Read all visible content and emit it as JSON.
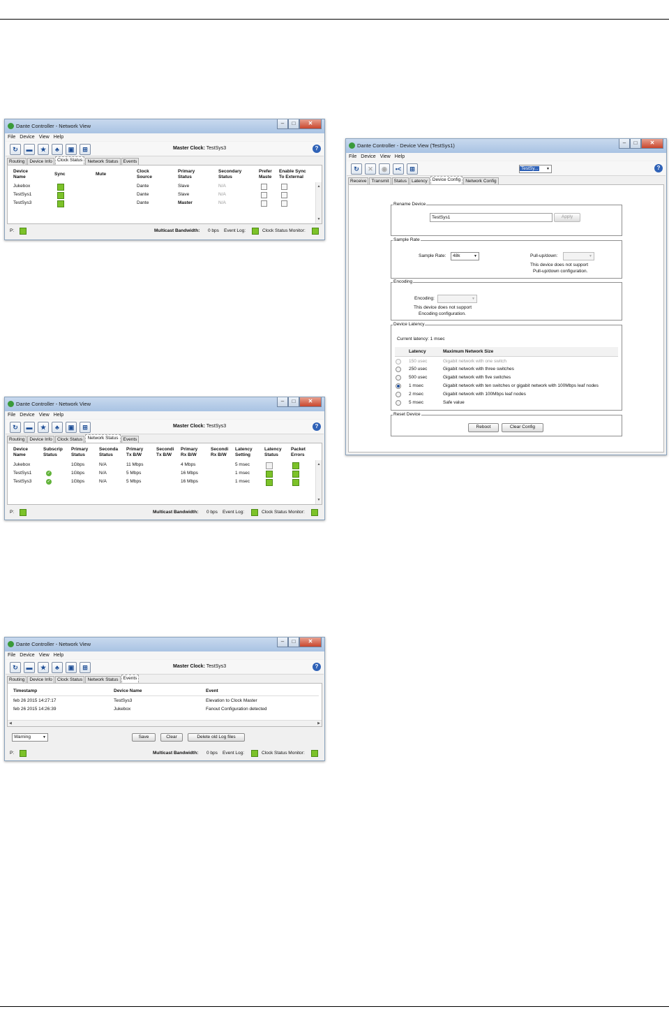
{
  "windows": {
    "network_title": "Dante Controller - Network View",
    "device_title": "Dante Controller - Device View (TestSys1)"
  },
  "menu": [
    "File",
    "Device",
    "View",
    "Help"
  ],
  "network_toolbar": {
    "master_clock_label": "Master Clock:",
    "master_clock_value": "TestSys3"
  },
  "network_tabs": [
    "Routing",
    "Device Info",
    "Clock Status",
    "Network Status",
    "Events"
  ],
  "clock_status": {
    "headers": [
      "Device\nName",
      "Sync",
      "Mute",
      "Clock\nSource",
      "Primary\nStatus",
      "Secondary\nStatus",
      "Prefer\nMaste",
      "Enable Sync\nTo External"
    ],
    "rows": [
      {
        "name": "Jukebox",
        "source": "Dante",
        "primary": "Slave",
        "secondary": "N/A"
      },
      {
        "name": "TestSys1",
        "source": "Dante",
        "primary": "Slave",
        "secondary": "N/A"
      },
      {
        "name": "TestSys3",
        "source": "Dante",
        "primary": "Master",
        "secondary": "N/A"
      }
    ]
  },
  "network_status": {
    "headers": [
      "Device\nName",
      "Subscrip\nStatus",
      "Primary\nStatus",
      "Seconda\nStatus",
      "Primary\nTx B/W",
      "Secondi\nTx B/W",
      "Primary\nRx B/W",
      "Secondi\nRx B/W",
      "Latency\nSetting",
      "Latency\nStatus",
      "Packet\nErrors"
    ],
    "rows": [
      {
        "name": "Jukebox",
        "primary": "1Gbps",
        "secondary": "N/A",
        "tx": "11 Mbps",
        "rx": "4 Mbps",
        "latency": "5 msec"
      },
      {
        "name": "TestSys1",
        "primary": "1Gbps",
        "secondary": "N/A",
        "tx": "5 Mbps",
        "rx": "16 Mbps",
        "latency": "1 msec"
      },
      {
        "name": "TestSys3",
        "primary": "1Gbps",
        "secondary": "N/A",
        "tx": "5 Mbps",
        "rx": "16 Mbps",
        "latency": "1 msec"
      }
    ]
  },
  "events": {
    "headers": [
      "Timestamp",
      "Device Name",
      "Event"
    ],
    "rows": [
      {
        "time": "feb 26 2015 14:27:17",
        "device": "TestSys3",
        "event": "Elevation to Clock Master"
      },
      {
        "time": "feb 26 2015 14:26:39",
        "device": "Jukebox",
        "event": "Fanout Configuration detected"
      }
    ],
    "filter": "Warning",
    "save": "Save",
    "clear": "Clear",
    "delete": "Delete old Log files"
  },
  "statusbar": {
    "p_label": "P:",
    "bandwidth_label": "Multicast Bandwidth:",
    "bandwidth_value": "0 bps",
    "event_log": "Event Log:",
    "clock_monitor": "Clock Status Monitor:"
  },
  "device_view": {
    "device_select": "TestSy...",
    "tabs": [
      "Receive",
      "Transmit",
      "Status",
      "Latency",
      "Device Config",
      "Network Config"
    ],
    "rename": {
      "legend": "Rename Device",
      "value": "TestSys1",
      "apply": "Apply"
    },
    "sample_rate": {
      "legend": "Sample Rate",
      "label": "Sample Rate:",
      "value": "48k",
      "pull_label": "Pull-up/down:",
      "pull_note_1": "This device does not support",
      "pull_note_2": "Pull-up/down configuration."
    },
    "encoding": {
      "legend": "Encoding",
      "label": "Encoding:",
      "note_1": "This device does not support",
      "note_2": "Encoding configuration."
    },
    "latency": {
      "legend": "Device Latency",
      "current": "Current latency: 1 msec",
      "col_latency": "Latency",
      "col_network": "Maximum Network Size",
      "options": [
        {
          "latency": "150 usec",
          "network": "Gigabit network with one switch"
        },
        {
          "latency": "250 usec",
          "network": "Gigabit network with three switches"
        },
        {
          "latency": "500 usec",
          "network": "Gigabit network with five switches"
        },
        {
          "latency": "1 msec",
          "network": "Gigabit network with ten switches or gigabit network with 100Mbps leaf nodes"
        },
        {
          "latency": "2 msec",
          "network": "Gigabit network with 100Mbps leaf nodes"
        },
        {
          "latency": "5 msec",
          "network": "Safe value"
        }
      ]
    },
    "reset": {
      "legend": "Reset Device",
      "reboot": "Reboot",
      "clear_config": "Clear Config"
    }
  }
}
